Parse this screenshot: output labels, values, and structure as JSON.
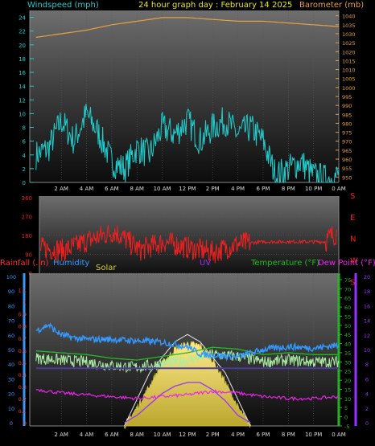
{
  "chart_data": [
    {
      "type": "line",
      "title": "24 hour graph day : February 14 2025",
      "left_axis_label": "Windspeed (mph)",
      "right_axis_label": "Barometer (mb)",
      "x_ticks": [
        "2 AM",
        "4 AM",
        "6 AM",
        "8 AM",
        "10 AM",
        "12 PM",
        "2 PM",
        "4 PM",
        "6 PM",
        "8 PM",
        "10 PM",
        "0 AM"
      ],
      "left_ticks": [
        0,
        2,
        4,
        6,
        8,
        10,
        12,
        14,
        16,
        18,
        20,
        22,
        24
      ],
      "left_range": [
        0,
        25
      ],
      "right_ticks": [
        950,
        955,
        960,
        965,
        970,
        975,
        980,
        985,
        990,
        995,
        1000,
        1005,
        1010,
        1015,
        1020,
        1025,
        1030,
        1035,
        1040
      ],
      "right_range": [
        947,
        1043
      ],
      "series": [
        {
          "name": "Windspeed (mph)",
          "axis": "left",
          "color": "#22cccc",
          "x": [
            0,
            1,
            2,
            3,
            4,
            5,
            6,
            7,
            8,
            9,
            10,
            11,
            12,
            13,
            14,
            15,
            16,
            17,
            18,
            19,
            20,
            21,
            22,
            23,
            24
          ],
          "y": [
            4,
            5,
            9,
            6,
            10,
            7,
            3,
            2,
            5,
            4,
            8,
            7,
            9,
            6,
            8,
            9,
            7,
            8,
            6,
            1,
            2,
            3,
            1,
            0.5,
            1
          ]
        },
        {
          "name": "Barometer (mb)",
          "axis": "right",
          "color": "#e8a040",
          "x": [
            0,
            2,
            4,
            6,
            8,
            10,
            12,
            14,
            16,
            18,
            20,
            22,
            24
          ],
          "y": [
            1028,
            1030,
            1032,
            1035,
            1037,
            1039,
            1039,
            1038,
            1037,
            1037,
            1036,
            1035,
            1034
          ]
        }
      ]
    },
    {
      "type": "line",
      "left_ticks": [
        0,
        90,
        180,
        270,
        360
      ],
      "left_range": [
        0,
        360
      ],
      "right_labels": [
        "S",
        "E",
        "N",
        "W",
        "S"
      ],
      "series": [
        {
          "name": "Wind direction",
          "color": "#ee2020",
          "x": [
            0,
            2,
            4,
            6,
            8,
            10,
            12,
            14,
            16,
            18,
            20,
            22,
            23,
            23.5,
            24
          ],
          "y": [
            120,
            110,
            160,
            200,
            110,
            150,
            120,
            100,
            140,
            150,
            150,
            150,
            150,
            180,
            190
          ]
        }
      ]
    },
    {
      "type": "line",
      "legend": [
        "Rainfall (.in)",
        "Humidity",
        "Solar",
        "UV",
        "Temperature (°F)",
        "Dew Point (°F)"
      ],
      "left_ticks_rain": [
        0,
        0.1,
        0.2,
        0.3,
        0.4,
        0.5,
        0.6,
        0.7,
        0.8,
        0.9,
        1,
        1.1
      ],
      "left_ticks_humidity": [
        0,
        10,
        20,
        30,
        40,
        50,
        60,
        70,
        80,
        90,
        100
      ],
      "right_ticks_temp": [
        -5,
        0,
        5,
        10,
        15,
        20,
        25,
        30,
        35,
        40,
        45,
        50,
        55,
        60,
        65,
        70,
        75
      ],
      "right_ticks_uv": [
        0,
        2,
        4,
        6,
        8,
        10,
        12,
        14,
        16,
        18,
        20
      ],
      "humidity_range": [
        0,
        100
      ],
      "temp_range": [
        -5,
        78.5
      ],
      "series": [
        {
          "name": "Humidity",
          "color": "#3399ff",
          "x": [
            0,
            1,
            1.5,
            2,
            3,
            4,
            6,
            8,
            10,
            12,
            13,
            14,
            16,
            18,
            20,
            22,
            24
          ],
          "y": [
            63,
            67,
            63,
            60,
            58,
            57,
            57,
            56,
            55,
            52,
            47,
            46,
            45,
            50,
            52,
            51,
            53
          ]
        },
        {
          "name": "Temperature (°F)",
          "color": "#22bb22",
          "x": [
            0,
            2,
            4,
            6,
            8,
            10,
            12,
            14,
            16,
            18,
            20,
            22,
            24
          ],
          "y": [
            32,
            31,
            30,
            28,
            27,
            29,
            31,
            34,
            33,
            30,
            31,
            30,
            30
          ]
        },
        {
          "name": "Dew Point (°F)",
          "color": "#ee22ee",
          "x": [
            0,
            2,
            4,
            6,
            8,
            10,
            12,
            14,
            16,
            18,
            20,
            22,
            24
          ],
          "y": [
            15,
            13,
            12,
            11,
            10,
            11,
            12,
            14,
            13,
            11,
            10,
            10,
            11
          ]
        },
        {
          "name": "Rainfall (.in)",
          "color": "#ff2a2a",
          "x": [
            0,
            2,
            4,
            6,
            8,
            10,
            12,
            14,
            16,
            18,
            20,
            22,
            24
          ],
          "y": [
            0.45,
            0.45,
            0.45,
            0.45,
            0.45,
            0.45,
            0.45,
            0.45,
            0.45,
            0.45,
            0.45,
            0.45,
            0.45
          ]
        },
        {
          "name": "Solar",
          "color": "#d8cc3a",
          "x": [
            7,
            8,
            9,
            10,
            11,
            12,
            13,
            14,
            15,
            16,
            17
          ],
          "y": [
            0,
            10,
            22,
            34,
            42,
            45,
            44,
            36,
            24,
            10,
            0
          ]
        },
        {
          "name": "UV",
          "color": "#9933ff",
          "x": [
            7,
            8,
            9,
            10,
            11,
            12,
            13,
            14,
            15,
            16,
            17
          ],
          "y": [
            0,
            1,
            2.5,
            4,
            5,
            5.5,
            5.5,
            4.5,
            3,
            1,
            0
          ]
        }
      ]
    }
  ]
}
